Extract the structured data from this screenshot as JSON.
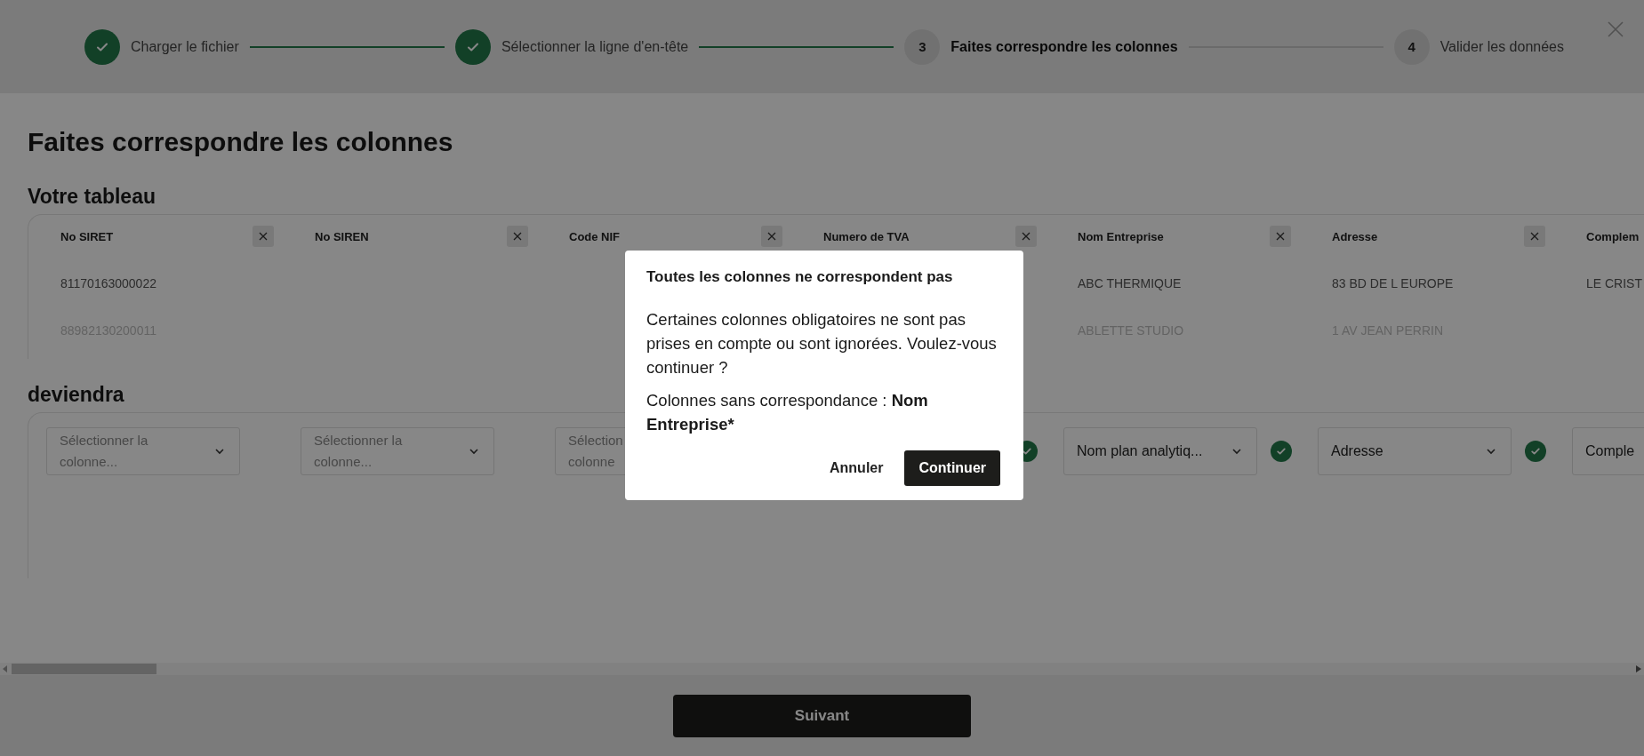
{
  "stepper": {
    "steps": [
      {
        "label": "Charger le fichier",
        "done": true,
        "current": false
      },
      {
        "label": "Sélectionner la ligne d'en-tête",
        "done": true,
        "current": false
      },
      {
        "number": "3",
        "label": "Faites correspondre les colonnes",
        "done": false,
        "current": true
      },
      {
        "number": "4",
        "label": "Valider les données",
        "done": false,
        "current": false
      }
    ]
  },
  "page_title": "Faites correspondre les colonnes",
  "table_heading": "Votre tableau",
  "columns": [
    {
      "header": "No SIRET",
      "removable": true,
      "cells": [
        "81170163000022",
        "88982130200011"
      ],
      "mapping": {
        "placeholder_lines": [
          "Sélectionner la",
          "colonne..."
        ],
        "chevron": true,
        "mapped": false
      }
    },
    {
      "header": "No SIREN",
      "removable": true,
      "mapping": {
        "placeholder_lines": [
          "Sélectionner la",
          "colonne..."
        ],
        "chevron": true,
        "mapped": false
      }
    },
    {
      "header": "Code NIF",
      "removable": true,
      "mapping": {
        "placeholder_lines": [
          "Sélection",
          "colonne"
        ]
      }
    },
    {
      "header": "Numero de TVA",
      "removable": true,
      "mapping": {
        "mapped": true
      }
    },
    {
      "header": "Nom Entreprise",
      "removable": true,
      "cells": [
        "ABC THERMIQUE",
        "ABLETTE STUDIO"
      ],
      "mapping": {
        "value": "Nom plan analytiq...",
        "chevron": true,
        "mapped": true
      }
    },
    {
      "header": "Adresse",
      "removable": true,
      "cells": [
        "83 BD DE L EUROPE",
        "1 AV JEAN PERRIN"
      ],
      "mapping": {
        "value": "Adresse",
        "chevron": true,
        "mapped": true
      }
    },
    {
      "header": "Complem",
      "cells": [
        "LE CRIST"
      ],
      "mapping": {
        "value": "Comple"
      }
    }
  ],
  "mapping_heading": "deviendra",
  "footer": {
    "next_button": "Suivant"
  },
  "dialog": {
    "title": "Toutes les colonnes ne correspondent pas",
    "message": "Certaines colonnes obligatoires ne sont pas prises en compte ou sont ignorées. Voulez-vous continuer ?",
    "missing_label": "Colonnes sans correspondance :",
    "missing_value": "Nom Entreprise*",
    "cancel_button": "Annuler",
    "confirm_button": "Continuer"
  }
}
